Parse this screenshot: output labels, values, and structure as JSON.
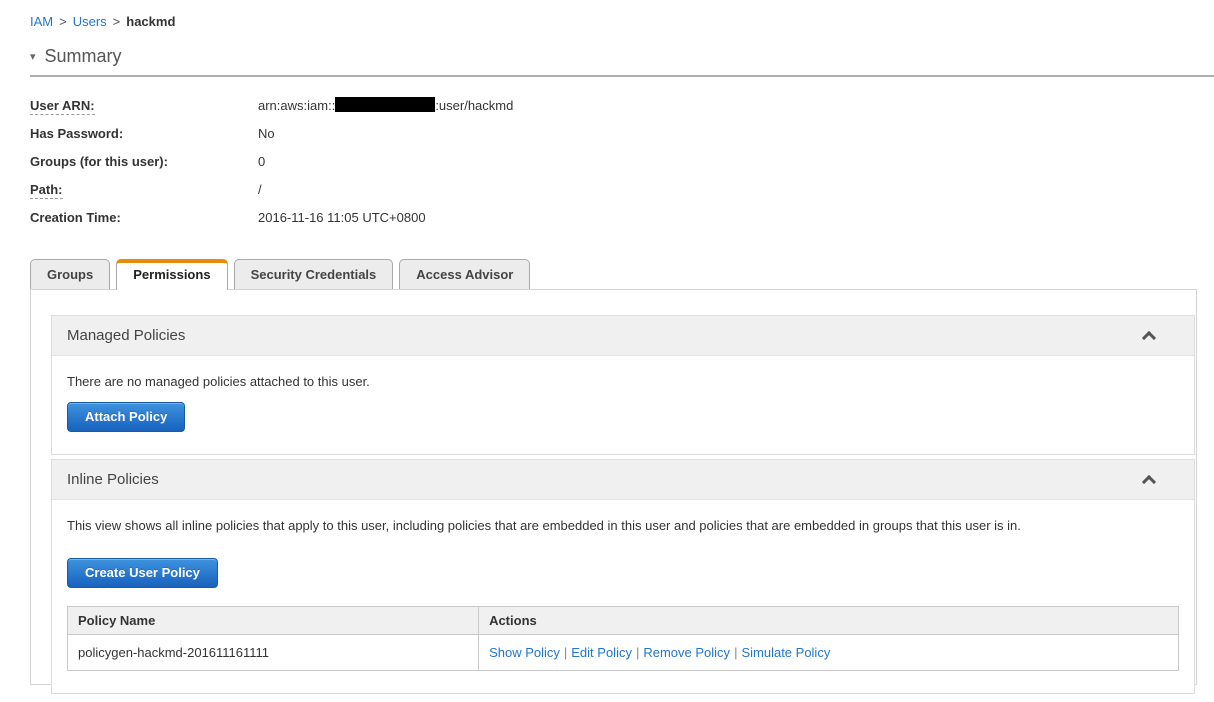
{
  "breadcrumb": {
    "separator": ">",
    "items": [
      {
        "label": "IAM"
      },
      {
        "label": "Users"
      },
      {
        "label": "hackmd"
      }
    ]
  },
  "icons": {
    "summary_collapse": "▾",
    "section_collapse": "chevron-up-icon"
  },
  "summary": {
    "title": "Summary",
    "fields": {
      "user_arn": {
        "label": "User ARN:",
        "prefix": "arn:aws:iam::",
        "suffix": ":user/hackmd",
        "account_id_redacted": true
      },
      "has_password": {
        "label": "Has Password:",
        "value": "No"
      },
      "groups_count": {
        "label": "Groups (for this user):",
        "value": "0"
      },
      "path": {
        "label": "Path:",
        "value": "/"
      },
      "creation_time": {
        "label": "Creation Time:",
        "value": "2016-11-16 11:05 UTC+0800"
      }
    }
  },
  "tabs": [
    {
      "label": "Groups",
      "active": false
    },
    {
      "label": "Permissions",
      "active": true
    },
    {
      "label": "Security Credentials",
      "active": false
    },
    {
      "label": "Access Advisor",
      "active": false
    }
  ],
  "permissions_tab": {
    "managed_policies": {
      "title": "Managed Policies",
      "empty_message": "There are no managed policies attached to this user.",
      "attach_button_label": "Attach Policy",
      "collapsed": false
    },
    "inline_policies": {
      "title": "Inline Policies",
      "description": "This view shows all inline policies that apply to this user, including policies that are embedded in this user and policies that are embedded in groups that this user is in.",
      "create_button_label": "Create User Policy",
      "collapsed": false,
      "table": {
        "headers": [
          "Policy Name",
          "Actions"
        ],
        "action_separator": "|",
        "rows": [
          {
            "policy_name": "policygen-hackmd-201611161111",
            "actions": [
              "Show Policy",
              "Edit Policy",
              "Remove Policy",
              "Simulate Policy"
            ]
          }
        ]
      }
    }
  },
  "colors": {
    "link_blue": "#2276cc",
    "active_tab_orange": "#e78c06",
    "primary_button_blue": "#2270c8",
    "section_header_bg": "#f0f0f0",
    "redaction_black": "#000000"
  }
}
